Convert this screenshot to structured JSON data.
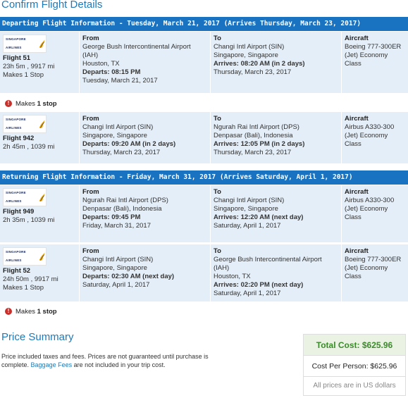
{
  "page_title": "Confirm Flight Details",
  "departing_header": "Departing Flight Information - Tuesday, March 21, 2017 (Arrives Thursday, March 23, 2017)",
  "returning_header": "Returning Flight Information - Friday, March 31, 2017 (Arrives Saturday, April 1, 2017)",
  "airline_logo_text": "SINGAPORE AIRLINES",
  "labels": {
    "from": "From",
    "to": "To",
    "aircraft": "Aircraft"
  },
  "flights": [
    {
      "flight": "Flight 51",
      "duration": "23h 5m , 9917 mi",
      "stops": "Makes 1 Stop",
      "from_airport": "George Bush Intercontinental Airport (IAH)",
      "from_city": "Houston, TX",
      "departs_label": "Departs:",
      "departs_time": "08:15 PM",
      "depart_date": "Tuesday, March 21, 2017",
      "to_airport": "Changi Intl Airport (SIN)",
      "to_city": "Singapore, Singapore",
      "arrives_label": "Arrives:",
      "arrives_time": "08:20 AM (in 2 days)",
      "arrive_date": "Thursday, March 23, 2017",
      "aircraft": "Boeing 777-300ER (Jet) Economy Class"
    },
    {
      "flight": "Flight 942",
      "duration": "2h 45m , 1039 mi",
      "stops": "",
      "from_airport": "Changi Intl Airport (SIN)",
      "from_city": "Singapore, Singapore",
      "departs_label": "Departs:",
      "departs_time": "09:20 AM (in 2 days)",
      "depart_date": "Thursday, March 23, 2017",
      "to_airport": "Ngurah Rai Intl Airport (DPS)",
      "to_city": "Denpasar (Bali), Indonesia",
      "arrives_label": "Arrives:",
      "arrives_time": "12:05 PM (in 2 days)",
      "arrive_date": "Thursday, March 23, 2017",
      "aircraft": "Airbus A330-300 (Jet) Economy Class"
    },
    {
      "flight": "Flight 949",
      "duration": "2h 35m , 1039 mi",
      "stops": "",
      "from_airport": "Ngurah Rai Intl Airport (DPS)",
      "from_city": "Denpasar (Bali), Indonesia",
      "departs_label": "Departs:",
      "departs_time": "09:45 PM",
      "depart_date": "Friday, March 31, 2017",
      "to_airport": "Changi Intl Airport (SIN)",
      "to_city": "Singapore, Singapore",
      "arrives_label": "Arrives:",
      "arrives_time": "12:20 AM (next day)",
      "arrive_date": "Saturday, April 1, 2017",
      "aircraft": "Airbus A330-300 (Jet) Economy Class"
    },
    {
      "flight": "Flight 52",
      "duration": "24h 50m , 9917 mi",
      "stops": "Makes 1 Stop",
      "from_airport": "Changi Intl Airport (SIN)",
      "from_city": "Singapore, Singapore",
      "departs_label": "Departs:",
      "departs_time": "02:30 AM (next day)",
      "depart_date": "Saturday, April 1, 2017",
      "to_airport": "George Bush Intercontinental Airport (IAH)",
      "to_city": "Houston, TX",
      "arrives_label": "Arrives:",
      "arrives_time": "02:20 PM (next day)",
      "arrive_date": "Saturday, April 1, 2017",
      "aircraft": "Boeing 777-300ER (Jet) Economy Class"
    }
  ],
  "makes_stop": {
    "prefix": "Makes",
    "count": "1 stop"
  },
  "price_summary": {
    "title": "Price Summary",
    "note_part1": "Price included taxes and fees. Prices are not guaranteed until purchase is complete.",
    "baggage_link": "Baggage Fees",
    "note_part2": "are not included in your trip cost.",
    "total_cost": "Total Cost: $625.96",
    "cost_per_person": "Cost Per Person: $625.96",
    "currency_note": "All prices are in US dollars"
  }
}
